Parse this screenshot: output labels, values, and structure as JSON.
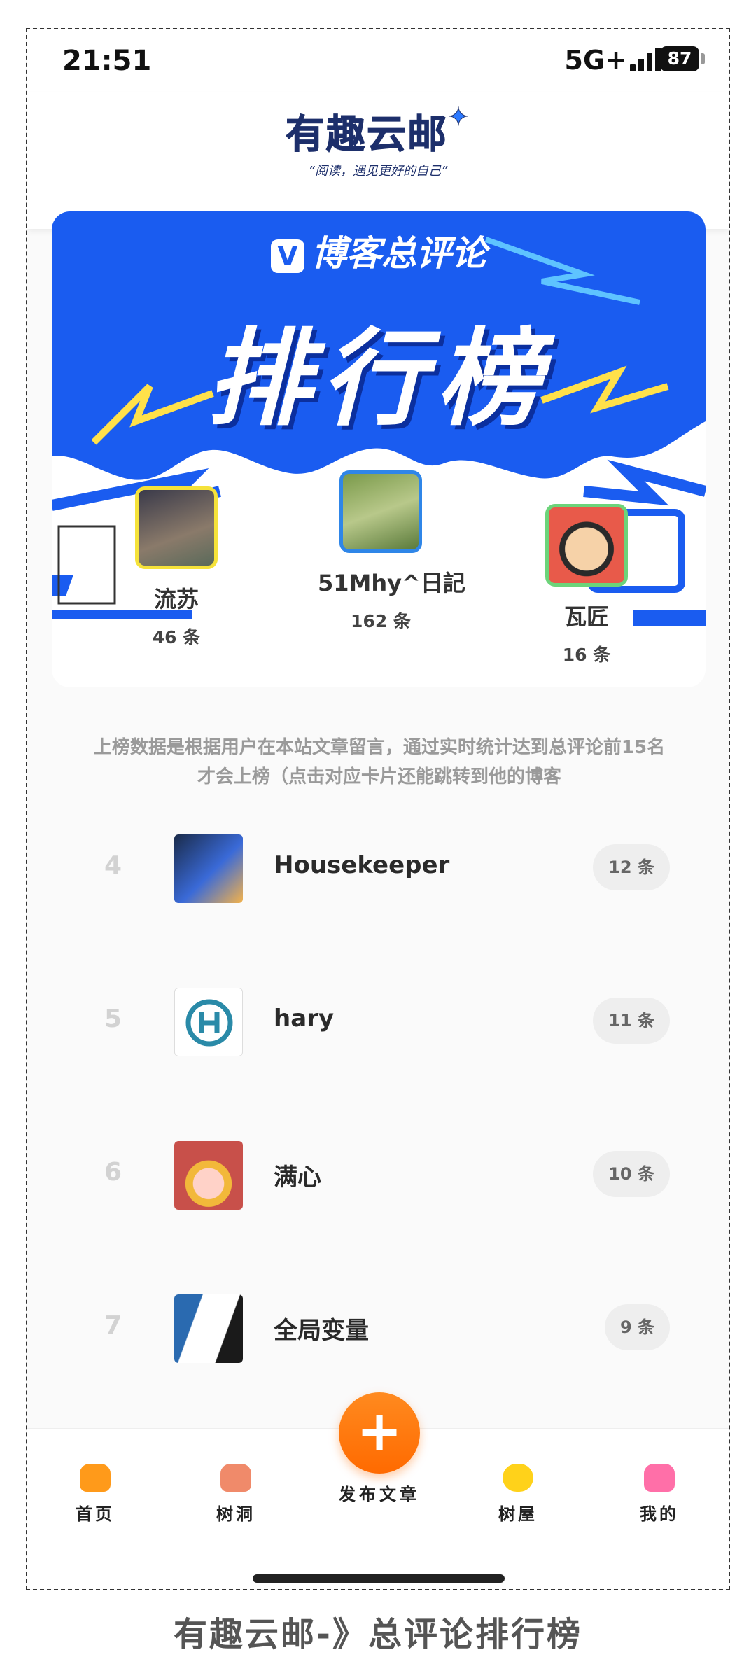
{
  "status_bar": {
    "time": "21:51",
    "network": "5G+",
    "battery": "87"
  },
  "header": {
    "app_name": "有趣云邮",
    "slogan": "“阅读，遇见更好的自己”"
  },
  "banner": {
    "brand": "博客总评论",
    "title": "排行榜"
  },
  "podium": [
    {
      "rank": 2,
      "name": "流苏",
      "count": "46 条",
      "border": "#f5e23a"
    },
    {
      "rank": 1,
      "name": "51Mhy^日記",
      "count": "162 条",
      "border": "#2f86e8"
    },
    {
      "rank": 3,
      "name": "瓦匠",
      "count": "16 条",
      "border": "#6cd47a"
    }
  ],
  "notice": {
    "line1": "上榜数据是根据用户在本站文章留言，通过实时统计达到总评论前15名",
    "line2": "才会上榜（点击对应卡片还能跳转到他的博客"
  },
  "list": [
    {
      "rank": "4",
      "name": "Housekeeper",
      "count": "12 条"
    },
    {
      "rank": "5",
      "name": "hary",
      "count": "11 条"
    },
    {
      "rank": "6",
      "name": "满心",
      "count": "10 条"
    },
    {
      "rank": "7",
      "name": "全局变量",
      "count": "9 条"
    }
  ],
  "nav": {
    "home": "首页",
    "treehole": "树洞",
    "publish": "发布文章",
    "treehouse": "树屋",
    "mine": "我的",
    "publish_icon": "+"
  },
  "colors": {
    "banner_blue": "#1a5cf0",
    "fab_orange": "#ff7a10",
    "nav_home": "#ff9a1a",
    "nav_treehole": "#f08a6a",
    "nav_treehouse": "#ffd21a",
    "nav_mine": "#ff6fa8"
  },
  "caption": "有趣云邮-》总评论排行榜"
}
